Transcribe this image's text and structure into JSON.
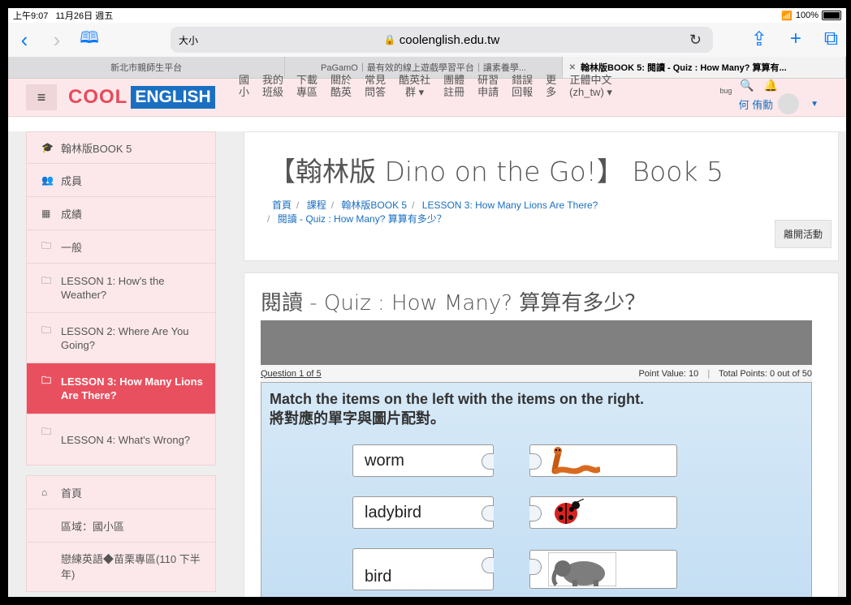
{
  "status": {
    "time": "上午9:07",
    "date": "11月26日 週五",
    "battery": "100%",
    "battery_level": 1.0
  },
  "safari": {
    "text_size": "大小",
    "url": "coolenglish.edu.tw"
  },
  "tabs": [
    {
      "label": "新北市親師生平台"
    },
    {
      "label": "PaGamO｜最有效的線上遊戲學習平台｜讓素養學..."
    },
    {
      "label": "翰林版BOOK 5: 閱讀 - Quiz : How Many? 算算有..."
    }
  ],
  "site": {
    "logo_cool": "COOL",
    "logo_english": "ENGLISH",
    "menu": [
      "國\n小",
      "我的\n班級",
      "下載\n專區",
      "關於\n酷英",
      "常見\n問答",
      "酷英社\n群 ▾",
      "團體\n註冊",
      "研習\n申請",
      "錯誤\n回報",
      "更\n多",
      "正體中文\n(zh_tw) ▾"
    ],
    "report_bug": "bug",
    "user_name": "何 侑勳"
  },
  "sidebar": {
    "course_items": [
      {
        "icon": "graduation-cap-icon",
        "glyph": "🎓",
        "label": "翰林版BOOK 5"
      },
      {
        "icon": "users-icon",
        "glyph": "👥",
        "label": "成員"
      },
      {
        "icon": "grades-table-icon",
        "glyph": "▦",
        "label": "成績"
      },
      {
        "icon": "folder-icon",
        "glyph": "🗀",
        "label": "一般"
      },
      {
        "icon": "folder-icon",
        "glyph": "🗀",
        "label": "LESSON 1: How's the Weather?"
      },
      {
        "icon": "folder-icon",
        "glyph": "🗀",
        "label": "LESSON 2: Where Are You Going?"
      },
      {
        "icon": "folder-icon",
        "glyph": "🗀",
        "label": "LESSON 3: How Many Lions Are There?"
      },
      {
        "icon": "folder-icon",
        "glyph": "🗀",
        "label": "LESSON 4: What's Wrong?"
      }
    ],
    "nav_items": [
      {
        "icon": "home-icon",
        "glyph": "⌂",
        "label": "首頁"
      },
      {
        "icon": "",
        "glyph": "",
        "label": "區域：國小區"
      },
      {
        "icon": "",
        "glyph": "",
        "label": "戀練英語◆苗栗專區(110 下半年)"
      }
    ]
  },
  "main": {
    "course_title": "【翰林版 Dino on the Go!】 Book 5",
    "breadcrumbs": [
      "首頁",
      "課程",
      "翰林版BOOK 5",
      "LESSON 3: How Many Lions Are There?",
      "閱讀 - Quiz : How Many? 算算有多少？"
    ],
    "leave_button": "離開活動",
    "quiz_title": "閱讀 - Quiz : How Many? 算算有多少？",
    "question_label": "Question 1 of 5",
    "point_value": "Point Value: 10",
    "total_points": "Total Points: 0 out of 50",
    "instruction_en": "Match the items on the left with the items on the right.",
    "instruction_zh": "將對應的單字與圖片配對。",
    "pairs": [
      {
        "word": "worm",
        "picture": "worm-picture"
      },
      {
        "word": "ladybird",
        "picture": "ladybird-picture"
      },
      {
        "word": "bird",
        "picture": "elephant-picture"
      }
    ]
  },
  "colors": {
    "accent": "#e9505f",
    "link": "#1a6fc0",
    "header_bg": "#fce8ea"
  }
}
